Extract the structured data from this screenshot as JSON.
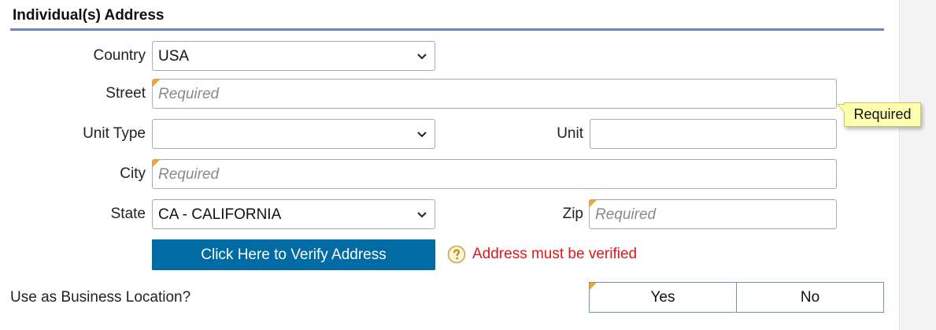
{
  "section": {
    "title": "Individual(s) Address"
  },
  "fields": {
    "country": {
      "label": "Country",
      "value": "USA"
    },
    "street": {
      "label": "Street",
      "placeholder": "Required"
    },
    "unit_type": {
      "label": "Unit Type",
      "value": ""
    },
    "unit": {
      "label": "Unit",
      "value": ""
    },
    "city": {
      "label": "City",
      "placeholder": "Required"
    },
    "state": {
      "label": "State",
      "value": "CA - CALIFORNIA"
    },
    "zip": {
      "label": "Zip",
      "placeholder": "Required"
    }
  },
  "tooltip": {
    "text": "Required"
  },
  "verify": {
    "button_label": "Click Here to Verify Address",
    "message": "Address must be verified",
    "help_icon": "question-circle-icon"
  },
  "business_location": {
    "question": "Use as Business Location?",
    "options": [
      "Yes",
      "No"
    ]
  },
  "colors": {
    "accent_rule": "#6a85c0",
    "button": "#006ca3",
    "error": "#e0161b",
    "required_marker": "#f5a623",
    "tooltip_bg": "#ffffb0"
  }
}
